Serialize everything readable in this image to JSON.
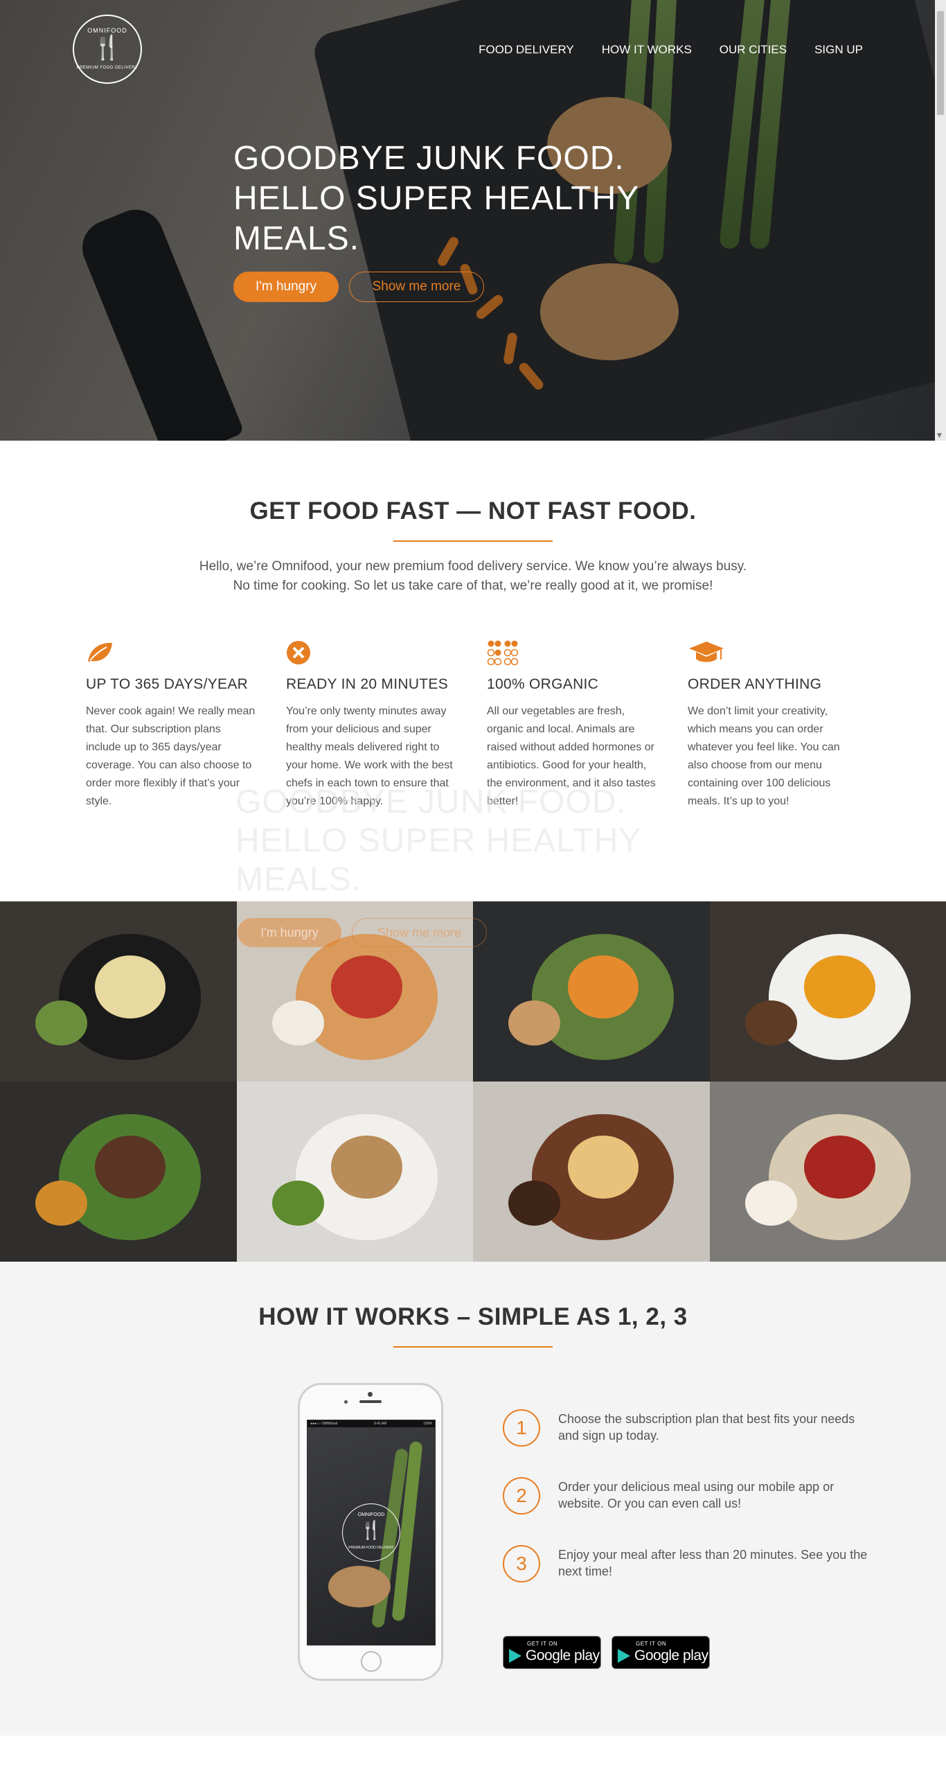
{
  "hero": {
    "logo_brand": "OMNIFOOD",
    "logo_tagline": "PREMIUM FOOD DELIVERY",
    "nav": [
      "Food delivery",
      "How it works",
      "Our cities",
      "Sign up"
    ],
    "title_line1": "Goodbye junk food.",
    "title_line2": "Hello super healthy",
    "title_line3": "meals.",
    "btn_primary": "I'm hungry",
    "btn_secondary": "Show me more"
  },
  "features": {
    "title": "GET FOOD FAST — NOT FAST FOOD.",
    "intro": "Hello, we’re Omnifood, your new premium food delivery service. We know you’re always busy. No time for cooking. So let us take care of that, we’re really good at it, we promise!",
    "items": [
      {
        "icon": "leaf-icon",
        "title": "UP TO 365 DAYS/YEAR",
        "text": "Never cook again! We really mean that. Our subscription plans include up to 365 days/year coverage. You can also choose to order more flexibly if that’s your style."
      },
      {
        "icon": "close-circle-icon",
        "title": "READY IN 20 MINUTES",
        "text": "You’re only twenty minutes away from your delicious and super healthy meals delivered right to your home. We work with the best chefs in each town to ensure that you’re 100% happy."
      },
      {
        "icon": "dots-icon",
        "title": "100% ORGANIC",
        "text": "All our vegetables are fresh, organic and local. Animals are raised without added hormones or antibiotics. Good for your health, the environment, and it also tastes better!"
      },
      {
        "icon": "graduation-cap-icon",
        "title": "ORDER ANYTHING",
        "text": "We don’t limit your creativity, which means you can order whatever you feel like. You can also choose from our menu containing over 100 delicious meals. It’s up to you!"
      }
    ]
  },
  "meals": [
    {
      "name": "bibimbap",
      "bg": "#3a3632",
      "c1": "#1a1a1a",
      "c2": "#e8d9a0",
      "c3": "#6b8e3d"
    },
    {
      "name": "pizza",
      "bg": "#cfc8bf",
      "c1": "#d99a5c",
      "c2": "#c0392b",
      "c3": "#f0ece4"
    },
    {
      "name": "chicken-asparagus",
      "bg": "#2b2c2e",
      "c1": "#5f7f3a",
      "c2": "#e68a2e",
      "c3": "#c99a66"
    },
    {
      "name": "pumpkin-soup",
      "bg": "#3b3631",
      "c1": "#f0f0ee",
      "c2": "#e89a1c",
      "c3": "#5e3b24"
    },
    {
      "name": "steak",
      "bg": "#2f2e2c",
      "c1": "#4f7d2f",
      "c2": "#5a3523",
      "c3": "#d08a2a"
    },
    {
      "name": "sandwich",
      "bg": "#dad8d4",
      "c1": "#f2f0ec",
      "c2": "#b98d5a",
      "c3": "#5e8b2e"
    },
    {
      "name": "burger",
      "bg": "#c7c2bb",
      "c1": "#6d3b23",
      "c2": "#e8c27a",
      "c3": "#3f2418"
    },
    {
      "name": "granola",
      "bg": "#7d7b78",
      "c1": "#d8cbb3",
      "c2": "#a7261f",
      "c3": "#f5efe6"
    }
  ],
  "how": {
    "title": "HOW IT WORKS – SIMPLE AS 1, 2, 3",
    "phone_logo_brand": "OMNIFOOD",
    "phone_logo_tagline": "PREMIUM FOOD DELIVERY",
    "phone_status_left": "●●●○○ OMNIfood",
    "phone_status_time": "9:41 AM",
    "phone_status_right": "100%",
    "steps": [
      {
        "num": "1",
        "text": "Choose the subscription plan that best fits your needs and sign up today."
      },
      {
        "num": "2",
        "text": "Order your delicious meal using our mobile app or website. Or you can even call us!"
      },
      {
        "num": "3",
        "text": "Enjoy your meal after less than 20 minutes. See you the next time!"
      }
    ],
    "badge_small": "GET IT ON",
    "badge_big": "Google play"
  },
  "colors": {
    "accent": "#e67e22"
  }
}
